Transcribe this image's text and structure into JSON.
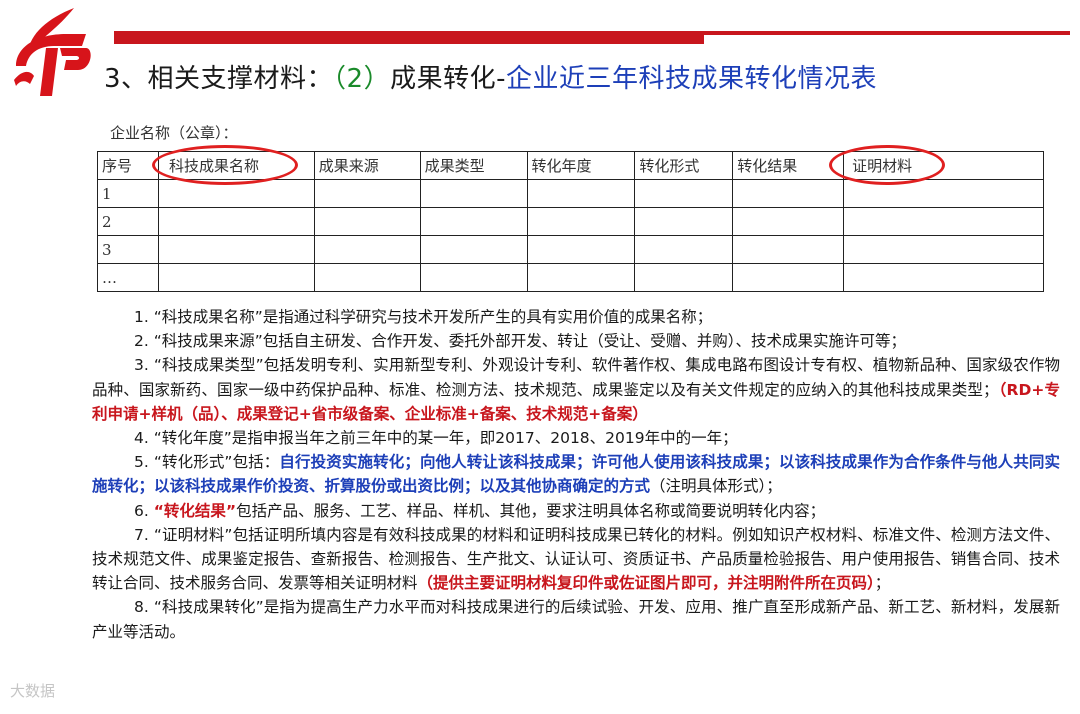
{
  "header": {
    "title_prefix": "3、相关支撑材料：",
    "title_num": "（2）",
    "title_mid": "成果转化-",
    "title_highlight": "企业近三年科技成果转化情况表",
    "brand_color": "#c8161d"
  },
  "form": {
    "company_label": "企业名称（公章）：",
    "headers": [
      "序号",
      "科技成果名称",
      "成果来源",
      "成果类型",
      "转化年度",
      "转化形式",
      "转化结果",
      "证明材料"
    ],
    "row_numbers": [
      "1",
      "2",
      "3",
      "…"
    ]
  },
  "notes": {
    "n1": "1. “科技成果名称”是指通过科学研究与技术开发所产生的具有实用价值的成果名称；",
    "n2": "2. “科技成果来源”包括自主研发、合作开发、委托外部开发、转让（受让、受赠、并购）、技术成果实施许可等；",
    "n3_text": "3. “科技成果类型”包括发明专利、实用新型专利、外观设计专利、软件著作权、集成电路布图设计专有权、植物新品种、国家级农作物品种、国家新药、国家一级中药保护品种、标准、检测方法、技术规范、成果鉴定以及有关文件规定的应纳入的其他科技成果类型；",
    "n3_red": "（RD+专利申请+样机（品）、成果登记+省市级备案、企业标准+备案、技术规范+备案）",
    "n4": "4. “转化年度”是指申报当年之前三年中的某一年，即2017、2018、2019年中的一年；",
    "n5_text": "5. “转化形式”包括：",
    "n5_blue": "自行投资实施转化；向他人转让该科技成果；许可他人使用该科技成果；以该科技成果作为合作条件与他人共同实施转化；以该科技成果作价投资、折算股份或出资比例；以及其他协商确定的方式",
    "n5_tail": "（注明具体形式）；",
    "n6_num": "6. ",
    "n6_red": "“转化结果”",
    "n6_text": "包括产品、服务、工艺、样品、样机、其他，要求注明具体名称或简要说明转化内容；",
    "n7_text": "7. “证明材料”包括证明所填内容是有效科技成果的材料和证明科技成果已转化的材料。例如知识产权材料、标准文件、检测方法文件、技术规范文件、成果鉴定报告、查新报告、检测报告、生产批文、认证认可、资质证书、产品质量检验报告、用户使用报告、销售合同、技术转让合同、技术服务合同、发票等相关证明材料",
    "n7_red": "（提供主要证明材料复印件或佐证图片即可，并注明附件所在页码）",
    "n7_tail": "；",
    "n8": "8. “科技成果转化”是指为提高生产力水平而对科技成果进行的后续试验、开发、应用、推广直至形成新产品、新工艺、新材料，发展新产业等活动。"
  },
  "watermark": "大数据"
}
